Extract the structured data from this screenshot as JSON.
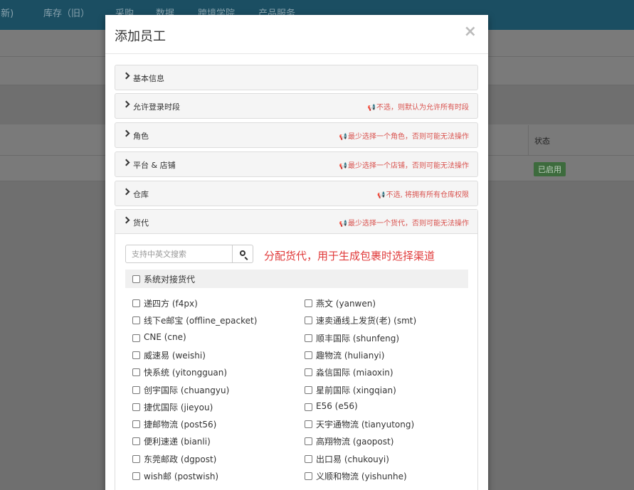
{
  "background": {
    "nav_items": [
      "(新)",
      "库存（旧）",
      "采购",
      "数据",
      "跨境学院",
      "产品服务"
    ],
    "table_header_status": "状态",
    "status_badge": "已启用"
  },
  "modal": {
    "title": "添加员工",
    "close_symbol": "×",
    "panels": [
      {
        "title": "基本信息",
        "hint": ""
      },
      {
        "title": "允许登录时段",
        "hint": "不选，则默认为允许所有时段"
      },
      {
        "title": "角色",
        "hint": "最少选择一个角色，否则可能无法操作"
      },
      {
        "title": "平台 & 店铺",
        "hint": "最少选择一个店铺，否则可能无法操作"
      },
      {
        "title": "仓库",
        "hint": "不选, 将拥有所有仓库权限"
      },
      {
        "title": "货代",
        "hint": "最少选择一个货代，否则可能无法操作"
      }
    ],
    "forwarder": {
      "search_placeholder": "支持中英文搜索",
      "note": "分配货代，用于生成包裹时选择渠道",
      "system_label": "系统对接货代",
      "options_left": [
        "递四方 (f4px)",
        "线下e邮宝 (offline_epacket)",
        "CNE (cne)",
        "威速易 (weishi)",
        "快系统 (yitongguan)",
        "创宇国际 (chuangyu)",
        "捷优国际 (jieyou)",
        "捷邮物流 (post56)",
        "便利速递 (bianli)",
        "东莞邮政 (dgpost)",
        "wish邮 (postwish)"
      ],
      "options_right": [
        "燕文 (yanwen)",
        "速卖通线上发货(老) (smt)",
        "顺丰国际 (shunfeng)",
        "趣物流 (hulianyi)",
        "淼信国际 (miaoxin)",
        "星前国际 (xingqian)",
        "E56 (e56)",
        "天宇通物流 (tianyutong)",
        "高翔物流 (gaopost)",
        "出口易 (chukouyi)",
        "义顺和物流 (yishunhe)"
      ]
    }
  },
  "colors": {
    "nav_bg": "#1b4e62",
    "hint_red": "#d9534f",
    "note_red": "#e03a3a"
  }
}
